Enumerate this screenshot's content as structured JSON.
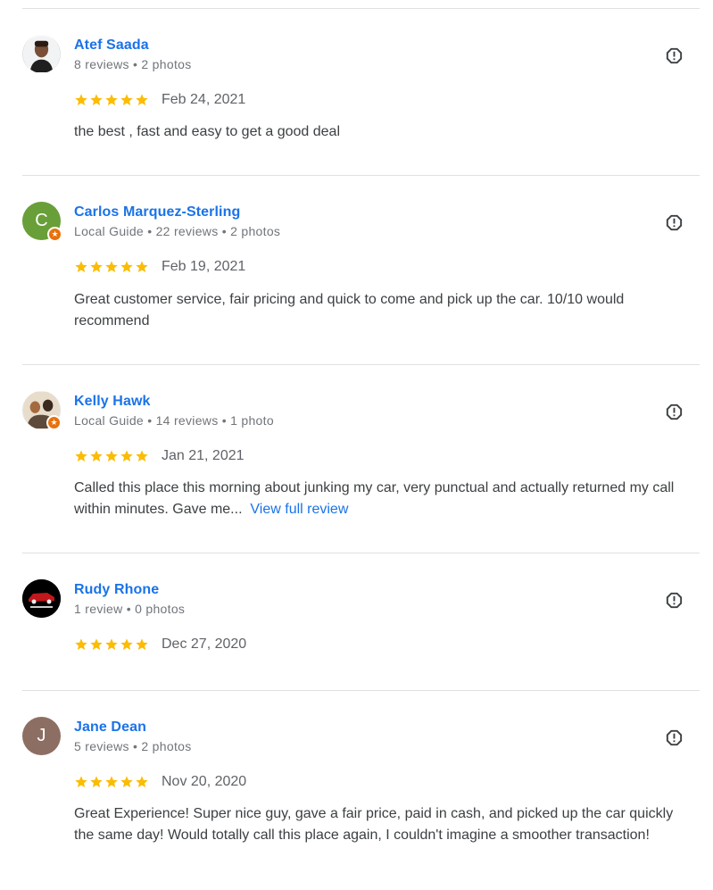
{
  "reviews": [
    {
      "name": "Atef Saada",
      "meta": "8 reviews • 2 photos",
      "date": "Feb 24, 2021",
      "rating": 5,
      "text": "the best , fast and easy to get a good deal",
      "more_label": ""
    },
    {
      "name": "Carlos Marquez-Sterling",
      "meta": "Local Guide • 22 reviews • 2 photos",
      "date": "Feb 19, 2021",
      "rating": 5,
      "avatar_letter": "C",
      "text": "Great customer service, fair pricing and quick to come and pick up the car. 10/10 would recommend",
      "more_label": ""
    },
    {
      "name": "Kelly Hawk",
      "meta": "Local Guide • 14 reviews • 1 photo",
      "date": "Jan 21, 2021",
      "rating": 5,
      "text": "Called this place this morning about junking my car, very punctual and actually returned my call within minutes. Gave me...",
      "more_label": "View full review"
    },
    {
      "name": "Rudy Rhone",
      "meta": "1 review • 0 photos",
      "date": "Dec 27, 2020",
      "rating": 5,
      "text": "",
      "more_label": ""
    },
    {
      "name": "Jane Dean",
      "meta": "5 reviews • 2 photos",
      "date": "Nov 20, 2020",
      "rating": 5,
      "avatar_letter": "J",
      "text": "Great Experience! Super nice guy, gave a fair price, paid in cash, and picked up the car quickly the same day! Would totally call this place again, I couldn't imagine a smoother transaction!",
      "more_label": ""
    }
  ],
  "colors": {
    "name_link": "#1a73e8",
    "star": "#fbbc04",
    "guide_badge": "#e8710a",
    "avatar_carlos": "#689f38",
    "avatar_jane": "#8d6e63"
  },
  "icons": {
    "report": "report-flag-icon",
    "star": "star-icon",
    "guide": "local-guide-badge-icon"
  }
}
